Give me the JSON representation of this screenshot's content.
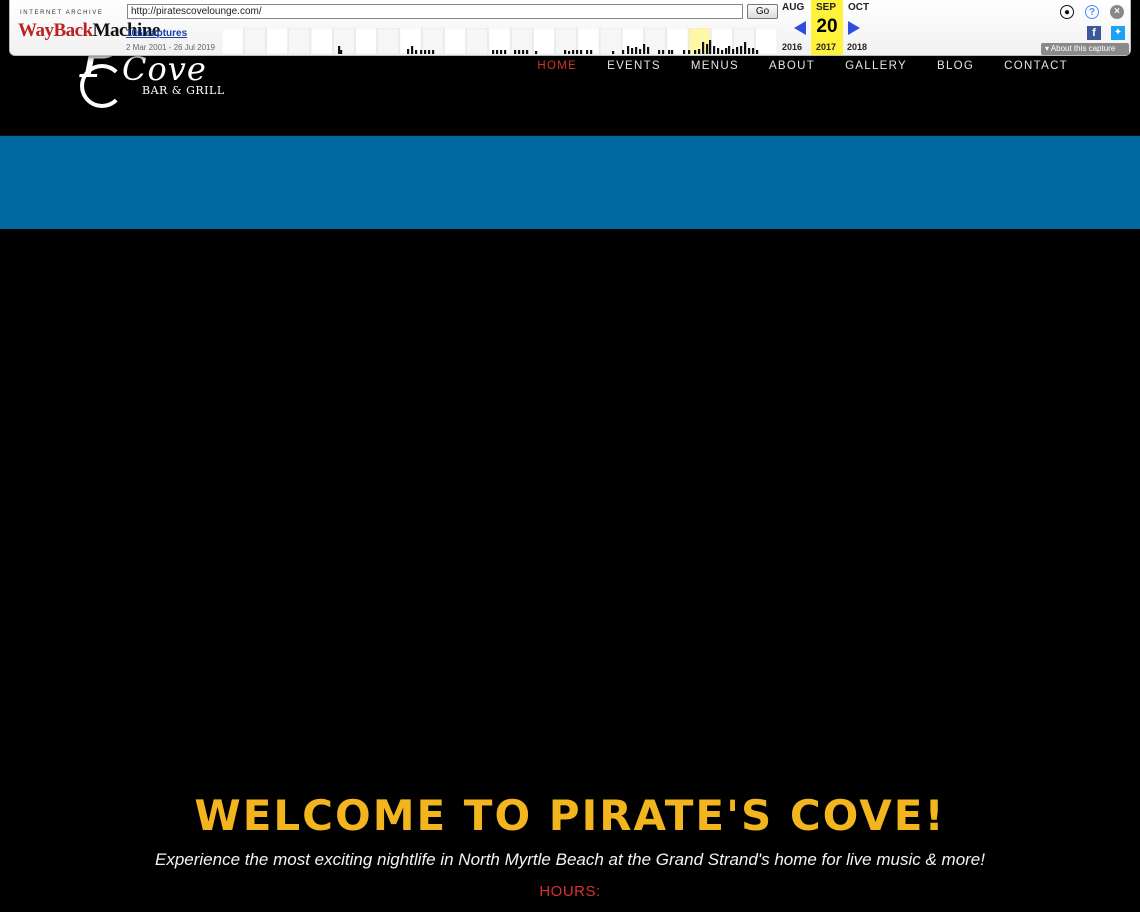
{
  "site": {
    "logo": {
      "script_text": "P",
      "name": "Cove",
      "tagline": "BAR & GRILL"
    },
    "nav": [
      {
        "label": "HOME",
        "active": true
      },
      {
        "label": "EVENTS",
        "active": false
      },
      {
        "label": "MENUS",
        "active": false
      },
      {
        "label": "ABOUT",
        "active": false
      },
      {
        "label": "GALLERY",
        "active": false
      },
      {
        "label": "BLOG",
        "active": false
      },
      {
        "label": "CONTACT",
        "active": false
      }
    ],
    "hero": {
      "title": "WELCOME TO PIRATE'S COVE!",
      "subtitle": "Experience the most exciting nightlife in North Myrtle Beach at the Grand Strand's home for live music & more!",
      "hours_label": "HOURS:"
    },
    "colors": {
      "header_bg": "#000000",
      "band_blue": "#006aa0",
      "title_gold": "#f2b51e",
      "accent_red": "#d8332b"
    }
  },
  "wayback": {
    "logo_top": "INTERNET ARCHIVE",
    "logo_way": "WayBack",
    "logo_machine": "Machine",
    "url": "http://piratescovelounge.com/",
    "go_label": "Go",
    "captures": "106 captures",
    "date_range": "2 Mar 2001 - 26 Jul 2019",
    "months": {
      "prev": "AUG",
      "current": "SEP",
      "next": "OCT"
    },
    "day": "20",
    "years": {
      "prev": "2016",
      "current": "2017",
      "next": "2018"
    },
    "about_label": "About this capture",
    "icons": [
      "user-icon",
      "help-icon",
      "close-icon",
      "facebook-icon",
      "twitter-icon"
    ]
  }
}
